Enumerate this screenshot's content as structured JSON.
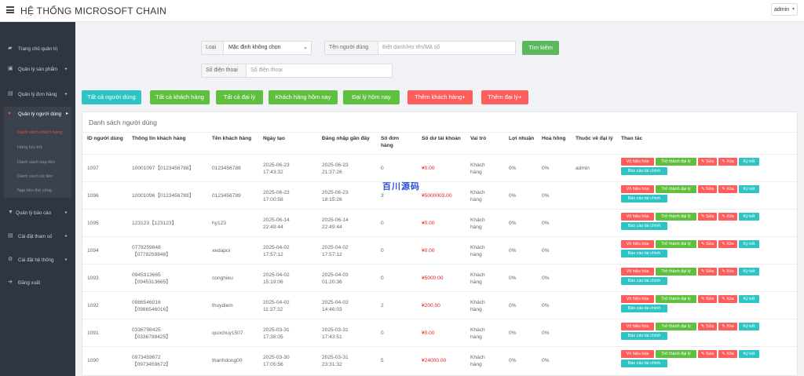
{
  "header": {
    "title": "HỆ THỐNG MICROSOFT CHAIN",
    "user": "admin"
  },
  "sidebar": {
    "items": [
      "Trang chủ quản trị",
      "Quản lý sản phẩm",
      "Quản lý đơn hàng",
      "Quản lý người dùng",
      "Quản lý báo cáo",
      "Cài đặt tham số",
      "Cài đặt hệ thống",
      "Đăng xuất"
    ],
    "sub_items": [
      "Danh sách khách hàng",
      "Hàng lưu trữ",
      "Danh sách nạp tiền",
      "Danh sách rút tiền",
      "Nạp tiền thủ công"
    ]
  },
  "filters": {
    "type_label": "Loại",
    "type_value": "Mặc định không chọn",
    "user_label": "Tên người dùng",
    "user_placeholder": "Biệt danh/Họ tên/Mã số",
    "search_button": "Tìm kiếm",
    "phone_label": "Số điện thoại",
    "phone_placeholder": "Số điện thoại"
  },
  "toolbar": {
    "buttons": [
      "Tất cả người dùng",
      "Tất cả khách hàng",
      "Tất cả đại lý",
      "Khách hàng hôm nay",
      "Đại lý hôm nay",
      "Thêm khách hàng+",
      "Thêm đại lý+"
    ]
  },
  "panel": {
    "title": "Danh sách người dùng"
  },
  "table": {
    "headers": [
      "ID người dùng",
      "Thông tin khách hàng",
      "Tên khách hàng",
      "Ngày tạo",
      "Đăng nhập gần đây",
      "Số đơn hàng",
      "Số dư tài khoản",
      "Vai trò",
      "Lợi nhuận",
      "Hoa hồng",
      "Thuộc về đại lý",
      "Thao tác"
    ],
    "rows": [
      {
        "id": "1097",
        "info1": "10001097【0123456788】",
        "info2": "",
        "name": "0123456788",
        "created1": "2025-06-23",
        "created2": "17:43:32",
        "login1": "2025-06-23",
        "login2": "21:37:26",
        "orders": "0",
        "balance": "¥0.00",
        "role1": "Khách",
        "role2": "hàng",
        "profit": "0%",
        "commission": "0%",
        "agent": "admin"
      },
      {
        "id": "1096",
        "info1": "10001096【0123456789】",
        "info2": "",
        "name": "0123456789",
        "created1": "2025-06-23",
        "created2": "17:00:58",
        "login1": "2025-06-23",
        "login2": "18:15:26",
        "orders": "3",
        "balance": "¥5000003.00",
        "role1": "Khách",
        "role2": "hàng",
        "profit": "0%",
        "commission": "0%",
        "agent": ""
      },
      {
        "id": "1095",
        "info1": "123123【123123】",
        "info2": "",
        "name": "hy123",
        "created1": "2025-06-14",
        "created2": "22:49:44",
        "login1": "2025-06-14",
        "login2": "22:49:44",
        "orders": "0",
        "balance": "¥0.00",
        "role1": "Khách",
        "role2": "hàng",
        "profit": "0%",
        "commission": "0%",
        "agent": ""
      },
      {
        "id": "1094",
        "info1": "0778259848",
        "info2": "【0778259848】",
        "name": "xedapoi",
        "created1": "2025-04-02",
        "created2": "17:57:12",
        "login1": "2025-04-02",
        "login2": "17:57:12",
        "orders": "0",
        "balance": "¥0.00",
        "role1": "Khách",
        "role2": "hàng",
        "profit": "0%",
        "commission": "0%",
        "agent": ""
      },
      {
        "id": "1093",
        "info1": "0945313665",
        "info2": "【0945313665】",
        "name": "conghieu",
        "created1": "2025-04-02",
        "created2": "15:19:06",
        "login1": "2025-04-03",
        "login2": "01:20:36",
        "orders": "0",
        "balance": "¥5000.00",
        "role1": "Khách",
        "role2": "hàng",
        "profit": "0%",
        "commission": "0%",
        "agent": ""
      },
      {
        "id": "1092",
        "info1": "0986546016",
        "info2": "【0986546016】",
        "name": "thuydiem",
        "created1": "2025-04-02",
        "created2": "11:37:32",
        "login1": "2025-04-03",
        "login2": "14:46:03",
        "orders": "2",
        "balance": "¥200.00",
        "role1": "Khách",
        "role2": "hàng",
        "profit": "0%",
        "commission": "0%",
        "agent": ""
      },
      {
        "id": "1091",
        "info1": "0336798425",
        "info2": "【0336798425】",
        "name": "quochuy1507",
        "created1": "2025-03-31",
        "created2": "17:38:05",
        "login1": "2025-03-31",
        "login2": "17:43:51",
        "orders": "0",
        "balance": "¥0.00",
        "role1": "Khách",
        "role2": "hàng",
        "profit": "0%",
        "commission": "0%",
        "agent": ""
      },
      {
        "id": "1090",
        "info1": "0973459672",
        "info2": "【0973459672】",
        "name": "thanhdong00",
        "created1": "2025-03-30",
        "created2": "17:05:56",
        "login1": "2025-03-31",
        "login2": "23:31:32",
        "orders": "5",
        "balance": "¥24000.00",
        "role1": "Khách",
        "role2": "hàng",
        "profit": "0%",
        "commission": "0%",
        "agent": ""
      }
    ],
    "actions": [
      "Vô hiệu hóa",
      "Trở thành đại lý",
      "✎ Sửa",
      "✎ Xóa",
      "Ký kết",
      "Báo cáo tài chính"
    ]
  },
  "watermark": "百川源码",
  "colors": {
    "sidebar": "#2f3640",
    "red": "#ff5c5c",
    "green": "#5fbf3f",
    "teal": "#2ec4c4",
    "search": "#5cb85c"
  }
}
